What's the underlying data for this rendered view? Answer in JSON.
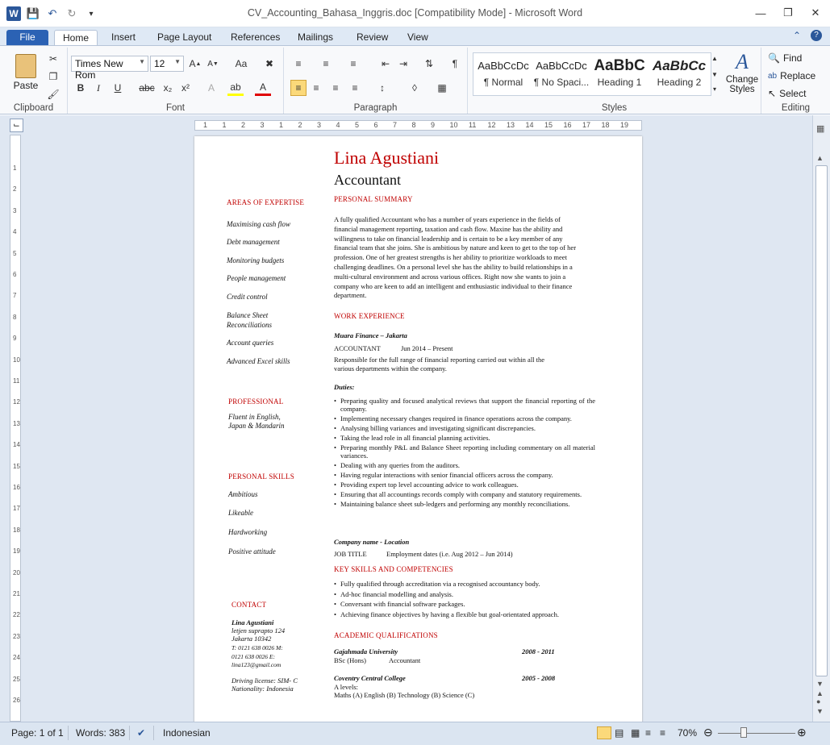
{
  "window": {
    "title": "CV_Accounting_Bahasa_Inggris.doc [Compatibility Mode]  -  Microsoft Word",
    "logo": "W"
  },
  "tabs": [
    "File",
    "Home",
    "Insert",
    "Page Layout",
    "References",
    "Mailings",
    "Review",
    "View"
  ],
  "ribbon": {
    "clipboard": {
      "paste": "Paste",
      "label": "Clipboard"
    },
    "font": {
      "family": "Times New Rom",
      "size": "12",
      "label": "Font",
      "change_case": "Aa",
      "bold": "B",
      "italic": "I",
      "underline": "U",
      "strike": "abc",
      "sub": "x₂",
      "sup": "x²"
    },
    "paragraph": {
      "label": "Paragraph"
    },
    "styles": {
      "label": "Styles",
      "items": [
        {
          "sample": "AaBbCcDc",
          "name": "¶ Normal"
        },
        {
          "sample": "AaBbCcDc",
          "name": "¶ No Spaci..."
        },
        {
          "sample": "AaBbC",
          "name": "Heading 1"
        },
        {
          "sample": "AaBbCc",
          "name": "Heading 2"
        }
      ],
      "change_styles": "Change Styles"
    },
    "editing": {
      "label": "Editing",
      "find": "Find",
      "replace": "Replace",
      "select": "Select"
    }
  },
  "ruler_ticks": [
    "1",
    "1",
    "2",
    "3",
    "1",
    "2",
    "3",
    "4",
    "5",
    "6",
    "7",
    "8",
    "9",
    "10",
    "11",
    "12",
    "13",
    "14",
    "15",
    "16",
    "17",
    "18",
    "19"
  ],
  "vruler_ticks": [
    "1",
    "2",
    "3",
    "4",
    "5",
    "6",
    "7",
    "8",
    "9",
    "10",
    "11",
    "12",
    "13",
    "14",
    "15",
    "16",
    "17",
    "18",
    "19",
    "20",
    "21",
    "22",
    "23",
    "24",
    "25",
    "26"
  ],
  "document": {
    "name": "Lina Agustiani",
    "job": "Accountant",
    "left": {
      "expertise_title": "AREAS OF EXPERTISE",
      "expertise": [
        "Maximising cash flow",
        "Debt management",
        "Monitoring budgets",
        "People management",
        "Credit control",
        "Balance Sheet",
        "Reconciliations",
        "Account queries",
        "Advanced Excel skills"
      ],
      "professional_title": "PROFESSIONAL",
      "professional": [
        "Fluent in English,",
        "Japan & Mandarin"
      ],
      "skills_title": "PERSONAL SKILLS",
      "skills": [
        "Ambitious",
        "Likeable",
        "Hardworking",
        "Positive attitude"
      ],
      "contact_title": "CONTACT",
      "contact_name": "Lina Agustiani",
      "contact_lines": [
        "letjen suprapto 124",
        "Jakarta 10342",
        "T: 0121 638 0026 M:",
        "0121 638 0026 E:",
        "lina123@gmail.com"
      ],
      "license": "Driving license: SIM- C",
      "nationality": "Nationality: Indonesia"
    },
    "summary_title": "PERSONAL SUMMARY",
    "summary_lines": [
      "A fully qualified Accountant who has a number of years experience in the fields of",
      "financial management reporting, taxation and cash flow. Maxine has the ability and",
      "willingness to take on financial leadership and is certain to be a key member of any",
      "financial team that she joins. She is ambitious by nature and keen to get to the top of her",
      "profession. One of her greatest strengths is her ability to prioritize workloads to meet",
      "challenging deadlines. On a personal level she has the ability to build relationships in a",
      "multi-cultural environment and across various offices. Right now she wants to join a",
      "company who are keen to add an intelligent and enthusiastic individual to their finance",
      "department."
    ],
    "work_title": "WORK EXPERIENCE",
    "employer": "Muara Finance – Jakarta",
    "role": "ACCOUNTANT",
    "role_dates": "Jun 2014 – Present",
    "resp_lines": [
      "Responsible for the full range of financial reporting carried out within all the",
      "various departments within the company."
    ],
    "duties_title": "Duties:",
    "duties": [
      "Preparing quality and focused analytical reviews that support the financial reporting of the company.",
      "Implementing necessary changes required in finance operations across the company.",
      "Analysing billing variances and investigating significant discrepancies.",
      "Taking the lead role in all financial planning activities.",
      "Preparing monthly P&L and Balance Sheet reporting including commentary on all material variances.",
      "Dealing with any queries from the auditors.",
      "Having regular interactions with senior financial officers across the company.",
      "Providing expert top level accounting advice to work colleagues.",
      "Ensuring that all accountings records comply with company and statutory requirements.",
      "Maintaining balance sheet sub-ledgers and performing any monthly reconciliations."
    ],
    "company2": "Company name - Location",
    "job2": "JOB TITLE",
    "job2_dates": "Employment dates (i.e. Aug 2012 – Jun 2014)",
    "key_title": "KEY SKILLS AND COMPETENCIES",
    "key_skills": [
      "Fully qualified through accreditation via a recognised accountancy body.",
      "Ad-hoc financial modelling and analysis.",
      "Conversant with financial software packages.",
      "Achieving finance objectives by having a flexible but goal-orientated approach."
    ],
    "academic_title": "ACADEMIC QUALIFICATIONS",
    "uni": "Gajahmada University",
    "uni_years": "2008 - 2011",
    "uni_degree": "BSc (Hons)",
    "uni_subject": "Accountant",
    "college": "Coventry Central College",
    "college_years": "2005 - 2008",
    "alevels": "A levels:",
    "alevel_subjects": "Maths (A) English (B) Technology (B) Science (C)"
  },
  "status": {
    "page": "Page: 1 of 1",
    "words": "Words: 383",
    "language": "Indonesian",
    "zoom": "70%"
  },
  "colors": {
    "accent": "#2b579a",
    "file_tab": "#2b62b4",
    "doc_heading": "#c00000"
  }
}
